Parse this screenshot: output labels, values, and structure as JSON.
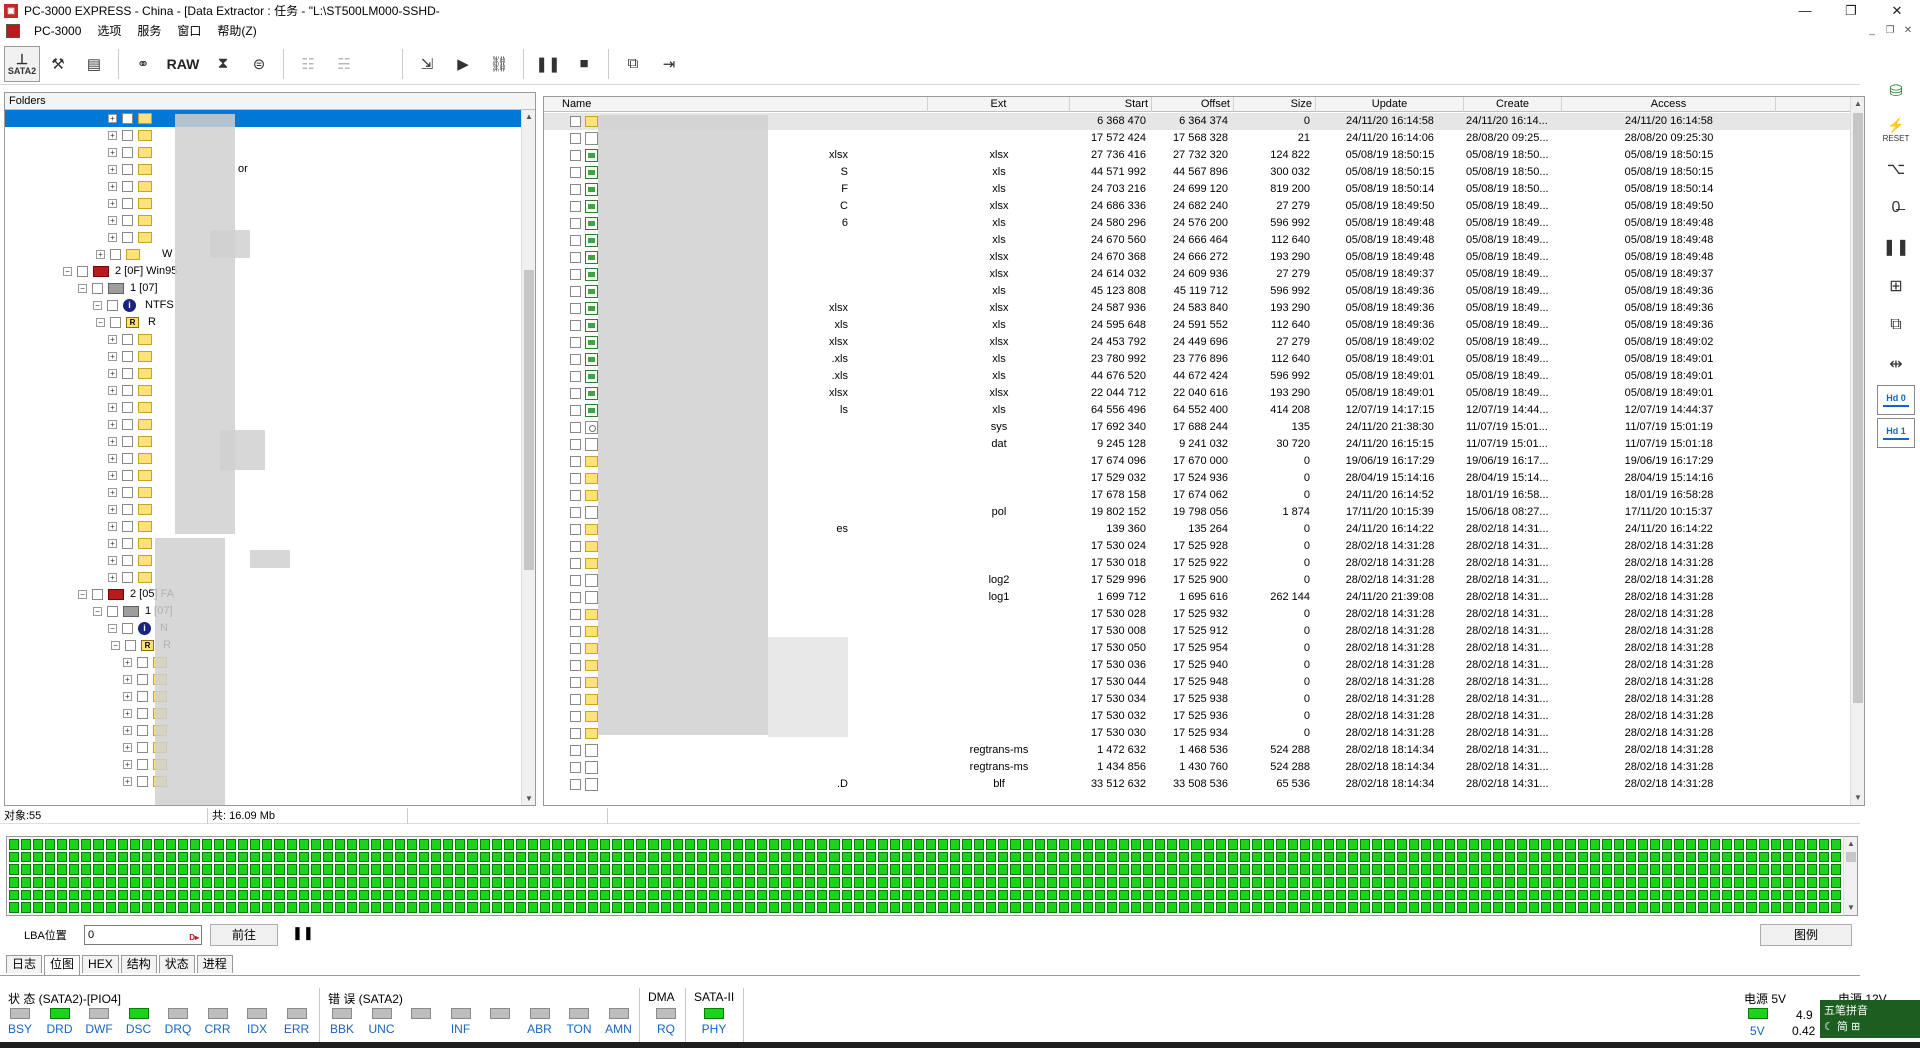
{
  "window": {
    "title": "PC-3000 EXPRESS - China - [Data Extractor : 任务 - \"L:\\ST500LM000-SSHD-",
    "app_icon": "pc3000-icon",
    "controls": [
      "—",
      "❐",
      "✕"
    ]
  },
  "menu": {
    "items": [
      "PC-3000",
      "选项",
      "服务",
      "窗口",
      "帮助(Z)"
    ]
  },
  "toolbar": {
    "sata_label": "SATA2",
    "raw_label": "RAW"
  },
  "rightbar": {
    "hd0": "Hd 0",
    "hd1": "Hd 1",
    "reset": "RESET"
  },
  "folders": {
    "header": "Folders",
    "nodes": [
      {
        "label": "2 [0F] Win95",
        "type": "disk"
      },
      {
        "label": "1 [07]",
        "type": "part"
      },
      {
        "label": "NTFS",
        "type": "info"
      },
      {
        "label": "R",
        "type": "root"
      },
      {
        "label": "2 [05] FA",
        "type": "disk"
      },
      {
        "label": "1 [07]",
        "type": "part"
      },
      {
        "label": "N",
        "type": "info"
      },
      {
        "label": "R",
        "type": "root"
      }
    ],
    "partial_labels": [
      "or",
      "W"
    ]
  },
  "table": {
    "columns": [
      "Name",
      "Ext",
      "Start",
      "Offset",
      "Size",
      "Update",
      "Create",
      "Access"
    ],
    "rows": [
      {
        "icon": "folder",
        "name": "",
        "ext": "",
        "start": "6 368 470",
        "offset": "6 364 374",
        "size": "0",
        "update": "24/11/20 16:14:58",
        "create": "24/11/20 16:14...",
        "access": "24/11/20 16:14:58"
      },
      {
        "icon": "file",
        "name": "",
        "ext": "",
        "start": "17 572 424",
        "offset": "17 568 328",
        "size": "21",
        "update": "24/11/20 16:14:06",
        "create": "28/08/20 09:25...",
        "access": "28/08/20 09:25:30"
      },
      {
        "icon": "xls",
        "name": "xlsx",
        "ext": "xlsx",
        "start": "27 736 416",
        "offset": "27 732 320",
        "size": "124 822",
        "update": "05/08/19 18:50:15",
        "create": "05/08/19 18:50...",
        "access": "05/08/19 18:50:15"
      },
      {
        "icon": "xls",
        "name": "S",
        "ext": "xls",
        "start": "44 571 992",
        "offset": "44 567 896",
        "size": "300 032",
        "update": "05/08/19 18:50:15",
        "create": "05/08/19 18:50...",
        "access": "05/08/19 18:50:15"
      },
      {
        "icon": "xls",
        "name": "F",
        "ext": "xls",
        "start": "24 703 216",
        "offset": "24 699 120",
        "size": "819 200",
        "update": "05/08/19 18:50:14",
        "create": "05/08/19 18:50...",
        "access": "05/08/19 18:50:14"
      },
      {
        "icon": "xls",
        "name": "C",
        "ext": "xlsx",
        "start": "24 686 336",
        "offset": "24 682 240",
        "size": "27 279",
        "update": "05/08/19 18:49:50",
        "create": "05/08/19 18:49...",
        "access": "05/08/19 18:49:50"
      },
      {
        "icon": "xls",
        "name": "6",
        "ext": "xls",
        "start": "24 580 296",
        "offset": "24 576 200",
        "size": "596 992",
        "update": "05/08/19 18:49:48",
        "create": "05/08/19 18:49...",
        "access": "05/08/19 18:49:48"
      },
      {
        "icon": "xls",
        "name": "",
        "ext": "xls",
        "start": "24 670 560",
        "offset": "24 666 464",
        "size": "112 640",
        "update": "05/08/19 18:49:48",
        "create": "05/08/19 18:49...",
        "access": "05/08/19 18:49:48"
      },
      {
        "icon": "xls",
        "name": "",
        "ext": "xlsx",
        "start": "24 670 368",
        "offset": "24 666 272",
        "size": "193 290",
        "update": "05/08/19 18:49:48",
        "create": "05/08/19 18:49...",
        "access": "05/08/19 18:49:48"
      },
      {
        "icon": "xls",
        "name": "",
        "ext": "xlsx",
        "start": "24 614 032",
        "offset": "24 609 936",
        "size": "27 279",
        "update": "05/08/19 18:49:37",
        "create": "05/08/19 18:49...",
        "access": "05/08/19 18:49:37"
      },
      {
        "icon": "xls",
        "name": "",
        "ext": "xls",
        "start": "45 123 808",
        "offset": "45 119 712",
        "size": "596 992",
        "update": "05/08/19 18:49:36",
        "create": "05/08/19 18:49...",
        "access": "05/08/19 18:49:36"
      },
      {
        "icon": "xls",
        "name": "xlsx",
        "ext": "xlsx",
        "start": "24 587 936",
        "offset": "24 583 840",
        "size": "193 290",
        "update": "05/08/19 18:49:36",
        "create": "05/08/19 18:49...",
        "access": "05/08/19 18:49:36"
      },
      {
        "icon": "xls",
        "name": "xls",
        "ext": "xls",
        "start": "24 595 648",
        "offset": "24 591 552",
        "size": "112 640",
        "update": "05/08/19 18:49:36",
        "create": "05/08/19 18:49...",
        "access": "05/08/19 18:49:36"
      },
      {
        "icon": "xls",
        "name": "xlsx",
        "ext": "xlsx",
        "start": "24 453 792",
        "offset": "24 449 696",
        "size": "27 279",
        "update": "05/08/19 18:49:02",
        "create": "05/08/19 18:49...",
        "access": "05/08/19 18:49:02"
      },
      {
        "icon": "xls",
        "name": ".xls",
        "ext": "xls",
        "start": "23 780 992",
        "offset": "23 776 896",
        "size": "112 640",
        "update": "05/08/19 18:49:01",
        "create": "05/08/19 18:49...",
        "access": "05/08/19 18:49:01"
      },
      {
        "icon": "xls",
        "name": ".xls",
        "ext": "xls",
        "start": "44 676 520",
        "offset": "44 672 424",
        "size": "596 992",
        "update": "05/08/19 18:49:01",
        "create": "05/08/19 18:49...",
        "access": "05/08/19 18:49:01"
      },
      {
        "icon": "xls",
        "name": "xlsx",
        "ext": "xlsx",
        "start": "22 044 712",
        "offset": "22 040 616",
        "size": "193 290",
        "update": "05/08/19 18:49:01",
        "create": "05/08/19 18:49...",
        "access": "05/08/19 18:49:01"
      },
      {
        "icon": "xls",
        "name": "ls",
        "ext": "xls",
        "start": "64 556 496",
        "offset": "64 552 400",
        "size": "414 208",
        "update": "12/07/19 14:17:15",
        "create": "12/07/19 14:44...",
        "access": "12/07/19 14:44:37"
      },
      {
        "icon": "sys",
        "name": "",
        "ext": "sys",
        "start": "17 692 340",
        "offset": "17 688 244",
        "size": "135",
        "update": "24/11/20 21:38:30",
        "create": "11/07/19 15:01...",
        "access": "11/07/19 15:01:19"
      },
      {
        "icon": "file",
        "name": "",
        "ext": "dat",
        "start": "9 245 128",
        "offset": "9 241 032",
        "size": "30 720",
        "update": "24/11/20 16:15:15",
        "create": "11/07/19 15:01...",
        "access": "11/07/19 15:01:18"
      },
      {
        "icon": "folder",
        "name": "",
        "ext": "",
        "start": "17 674 096",
        "offset": "17 670 000",
        "size": "0",
        "update": "19/06/19 16:17:29",
        "create": "19/06/19 16:17...",
        "access": "19/06/19 16:17:29"
      },
      {
        "icon": "folder",
        "name": "",
        "ext": "",
        "start": "17 529 032",
        "offset": "17 524 936",
        "size": "0",
        "update": "28/04/19 15:14:16",
        "create": "28/04/19 15:14...",
        "access": "28/04/19 15:14:16"
      },
      {
        "icon": "folder",
        "name": "",
        "ext": "",
        "start": "17 678 158",
        "offset": "17 674 062",
        "size": "0",
        "update": "24/11/20 16:14:52",
        "create": "18/01/19 16:58...",
        "access": "18/01/19 16:58:28"
      },
      {
        "icon": "file",
        "name": "",
        "ext": "pol",
        "start": "19 802 152",
        "offset": "19 798 056",
        "size": "1 874",
        "update": "17/11/20 10:15:39",
        "create": "15/06/18 08:27...",
        "access": "17/11/20 10:15:37"
      },
      {
        "icon": "folder",
        "name": "es",
        "ext": "",
        "start": "139 360",
        "offset": "135 264",
        "size": "0",
        "update": "24/11/20 16:14:22",
        "create": "28/02/18 14:31...",
        "access": "24/11/20 16:14:22"
      },
      {
        "icon": "folder",
        "name": "",
        "ext": "",
        "start": "17 530 024",
        "offset": "17 525 928",
        "size": "0",
        "update": "28/02/18 14:31:28",
        "create": "28/02/18 14:31...",
        "access": "28/02/18 14:31:28"
      },
      {
        "icon": "folder",
        "name": "",
        "ext": "",
        "start": "17 530 018",
        "offset": "17 525 922",
        "size": "0",
        "update": "28/02/18 14:31:28",
        "create": "28/02/18 14:31...",
        "access": "28/02/18 14:31:28"
      },
      {
        "icon": "file",
        "name": "",
        "ext": "log2",
        "start": "17 529 996",
        "offset": "17 525 900",
        "size": "0",
        "update": "28/02/18 14:31:28",
        "create": "28/02/18 14:31...",
        "access": "28/02/18 14:31:28"
      },
      {
        "icon": "file",
        "name": "",
        "ext": "log1",
        "start": "1 699 712",
        "offset": "1 695 616",
        "size": "262 144",
        "update": "24/11/20 21:39:08",
        "create": "28/02/18 14:31...",
        "access": "28/02/18 14:31:28"
      },
      {
        "icon": "folder",
        "name": "",
        "ext": "",
        "start": "17 530 028",
        "offset": "17 525 932",
        "size": "0",
        "update": "28/02/18 14:31:28",
        "create": "28/02/18 14:31...",
        "access": "28/02/18 14:31:28"
      },
      {
        "icon": "folder",
        "name": "",
        "ext": "",
        "start": "17 530 008",
        "offset": "17 525 912",
        "size": "0",
        "update": "28/02/18 14:31:28",
        "create": "28/02/18 14:31...",
        "access": "28/02/18 14:31:28"
      },
      {
        "icon": "folder",
        "name": "",
        "ext": "",
        "start": "17 530 050",
        "offset": "17 525 954",
        "size": "0",
        "update": "28/02/18 14:31:28",
        "create": "28/02/18 14:31...",
        "access": "28/02/18 14:31:28"
      },
      {
        "icon": "folder",
        "name": "",
        "ext": "",
        "start": "17 530 036",
        "offset": "17 525 940",
        "size": "0",
        "update": "28/02/18 14:31:28",
        "create": "28/02/18 14:31...",
        "access": "28/02/18 14:31:28"
      },
      {
        "icon": "folder",
        "name": "",
        "ext": "",
        "start": "17 530 044",
        "offset": "17 525 948",
        "size": "0",
        "update": "28/02/18 14:31:28",
        "create": "28/02/18 14:31...",
        "access": "28/02/18 14:31:28"
      },
      {
        "icon": "folder",
        "name": "",
        "ext": "",
        "start": "17 530 034",
        "offset": "17 525 938",
        "size": "0",
        "update": "28/02/18 14:31:28",
        "create": "28/02/18 14:31...",
        "access": "28/02/18 14:31:28"
      },
      {
        "icon": "folder",
        "name": "",
        "ext": "",
        "start": "17 530 032",
        "offset": "17 525 936",
        "size": "0",
        "update": "28/02/18 14:31:28",
        "create": "28/02/18 14:31...",
        "access": "28/02/18 14:31:28"
      },
      {
        "icon": "folder",
        "name": "",
        "ext": "",
        "start": "17 530 030",
        "offset": "17 525 934",
        "size": "0",
        "update": "28/02/18 14:31:28",
        "create": "28/02/18 14:31...",
        "access": "28/02/18 14:31:28"
      },
      {
        "icon": "file",
        "name": "",
        "ext": "regtrans-ms",
        "start": "1 472 632",
        "offset": "1 468 536",
        "size": "524 288",
        "update": "28/02/18 18:14:34",
        "create": "28/02/18 14:31...",
        "access": "28/02/18 14:31:28"
      },
      {
        "icon": "file",
        "name": "",
        "ext": "regtrans-ms",
        "start": "1 434 856",
        "offset": "1 430 760",
        "size": "524 288",
        "update": "28/02/18 18:14:34",
        "create": "28/02/18 14:31...",
        "access": "28/02/18 14:31:28"
      },
      {
        "icon": "file",
        "name": ".D",
        "ext": "blf",
        "start": "33 512 632",
        "offset": "33 508 536",
        "size": "65 536",
        "update": "28/02/18 18:14:34",
        "create": "28/02/18 14:31...",
        "access": "28/02/18 14:31:28"
      }
    ]
  },
  "status": {
    "objects": "对象:55",
    "total": "共: 16.09 Mb"
  },
  "lba": {
    "label": "LBA位置",
    "value": "0",
    "go_button": "前往",
    "legend_button": "图例"
  },
  "tabs": [
    "日志",
    "位图",
    "HEX",
    "结构",
    "状态",
    "进程"
  ],
  "registers": {
    "status_title": "状 态 (SATA2)-[PIO4]",
    "status_leds": [
      {
        "name": "BSY",
        "on": false
      },
      {
        "name": "DRD",
        "on": true
      },
      {
        "name": "DWF",
        "on": false
      },
      {
        "name": "DSC",
        "on": true
      },
      {
        "name": "DRQ",
        "on": false
      },
      {
        "name": "CRR",
        "on": false
      },
      {
        "name": "IDX",
        "on": false
      },
      {
        "name": "ERR",
        "on": false
      }
    ],
    "error_title": "错 误 (SATA2)",
    "error_leds": [
      {
        "name": "BBK",
        "on": false
      },
      {
        "name": "UNC",
        "on": false
      },
      {
        "name": "",
        "on": false
      },
      {
        "name": "INF",
        "on": false
      },
      {
        "name": "",
        "on": false
      },
      {
        "name": "ABR",
        "on": false
      },
      {
        "name": "TON",
        "on": false
      },
      {
        "name": "AMN",
        "on": false
      }
    ],
    "dma_title": "DMA",
    "dma_leds": [
      {
        "name": "RQ",
        "on": false
      }
    ],
    "sata_title": "SATA-II",
    "sata_leds": [
      {
        "name": "PHY",
        "on": true
      }
    ]
  },
  "power": {
    "title": "电源 5V",
    "label": "5V",
    "voltage": "4.9",
    "current": "0.42",
    "title12": "电源 12V"
  },
  "ime": {
    "label": "五笔拼音",
    "row2": "☾ 简 ⊞"
  },
  "colors": {
    "led_on": "#19d419",
    "selection": "#0078d7",
    "accent": "#1565c0"
  }
}
